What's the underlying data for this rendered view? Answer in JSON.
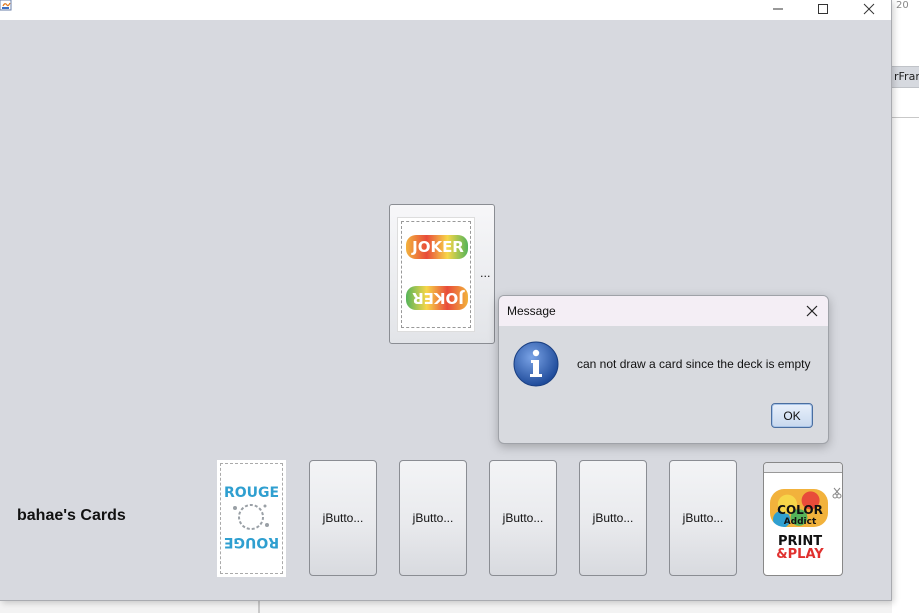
{
  "background_ide": {
    "right_number": "20",
    "right_tab_text": "rFram"
  },
  "game": {
    "deck_button": {
      "label": "...",
      "card_text_top": "JOKER",
      "card_text_bottom": "JOKER"
    },
    "player_label": "bahae's Cards",
    "hand": {
      "first_card_text_top": "ROUGE",
      "first_card_text_bottom": "ROUGE",
      "buttons": [
        "jButto...",
        "jButto...",
        "jButto...",
        "jButto...",
        "jButto..."
      ],
      "last_card_texts": [
        "COLOR",
        "Addict",
        "PRINT",
        "&PLAY"
      ]
    }
  },
  "dialog": {
    "title": "Message",
    "message": "can not draw a card since the deck is empty",
    "ok_label": "OK"
  },
  "colors": {
    "frame_bg": "#d7d9df",
    "dialog_title_bg": "#f4eef5",
    "info_icon": "#2f5fae",
    "rouge": "#2f9fd0"
  }
}
